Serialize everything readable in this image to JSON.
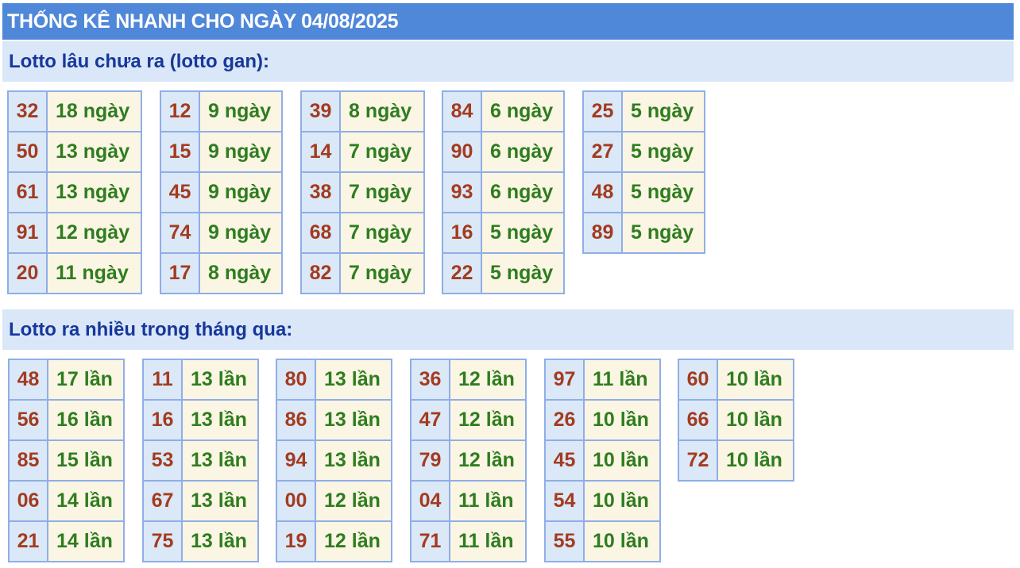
{
  "header": {
    "title": "THỐNG KÊ NHANH CHO NGÀY 04/08/2025"
  },
  "sections": {
    "gan": {
      "title": "Lotto lâu chưa ra (lotto gan):",
      "groups": [
        [
          {
            "number": "32",
            "value": "18 ngày"
          },
          {
            "number": "50",
            "value": "13 ngày"
          },
          {
            "number": "61",
            "value": "13 ngày"
          },
          {
            "number": "91",
            "value": "12 ngày"
          },
          {
            "number": "20",
            "value": "11 ngày"
          }
        ],
        [
          {
            "number": "12",
            "value": "9 ngày"
          },
          {
            "number": "15",
            "value": "9 ngày"
          },
          {
            "number": "45",
            "value": "9 ngày"
          },
          {
            "number": "74",
            "value": "9 ngày"
          },
          {
            "number": "17",
            "value": "8 ngày"
          }
        ],
        [
          {
            "number": "39",
            "value": "8 ngày"
          },
          {
            "number": "14",
            "value": "7 ngày"
          },
          {
            "number": "38",
            "value": "7 ngày"
          },
          {
            "number": "68",
            "value": "7 ngày"
          },
          {
            "number": "82",
            "value": "7 ngày"
          }
        ],
        [
          {
            "number": "84",
            "value": "6 ngày"
          },
          {
            "number": "90",
            "value": "6 ngày"
          },
          {
            "number": "93",
            "value": "6 ngày"
          },
          {
            "number": "16",
            "value": "5 ngày"
          },
          {
            "number": "22",
            "value": "5 ngày"
          }
        ],
        [
          {
            "number": "25",
            "value": "5 ngày"
          },
          {
            "number": "27",
            "value": "5 ngày"
          },
          {
            "number": "48",
            "value": "5 ngày"
          },
          {
            "number": "89",
            "value": "5 ngày"
          }
        ]
      ]
    },
    "nhieu": {
      "title": "Lotto ra nhiều trong tháng qua:",
      "groups": [
        [
          {
            "number": "48",
            "value": "17 lần"
          },
          {
            "number": "56",
            "value": "16 lần"
          },
          {
            "number": "85",
            "value": "15 lần"
          },
          {
            "number": "06",
            "value": "14 lần"
          },
          {
            "number": "21",
            "value": "14 lần"
          }
        ],
        [
          {
            "number": "11",
            "value": "13 lần"
          },
          {
            "number": "16",
            "value": "13 lần"
          },
          {
            "number": "53",
            "value": "13 lần"
          },
          {
            "number": "67",
            "value": "13 lần"
          },
          {
            "number": "75",
            "value": "13 lần"
          }
        ],
        [
          {
            "number": "80",
            "value": "13 lần"
          },
          {
            "number": "86",
            "value": "13 lần"
          },
          {
            "number": "94",
            "value": "13 lần"
          },
          {
            "number": "00",
            "value": "12 lần"
          },
          {
            "number": "19",
            "value": "12 lần"
          }
        ],
        [
          {
            "number": "36",
            "value": "12 lần"
          },
          {
            "number": "47",
            "value": "12 lần"
          },
          {
            "number": "79",
            "value": "12 lần"
          },
          {
            "number": "04",
            "value": "11 lần"
          },
          {
            "number": "71",
            "value": "11 lần"
          }
        ],
        [
          {
            "number": "97",
            "value": "11 lần"
          },
          {
            "number": "26",
            "value": "10 lần"
          },
          {
            "number": "45",
            "value": "10 lần"
          },
          {
            "number": "54",
            "value": "10 lần"
          },
          {
            "number": "55",
            "value": "10 lần"
          }
        ],
        [
          {
            "number": "60",
            "value": "10 lần"
          },
          {
            "number": "66",
            "value": "10 lần"
          },
          {
            "number": "72",
            "value": "10 lần"
          }
        ]
      ]
    }
  },
  "colors": {
    "header_bg": "#4f87d9",
    "section_bg": "#d9e7f8",
    "section_text": "#17379a",
    "number_cell_bg": "#dbe8f7",
    "number_text": "#a33b1f",
    "value_cell_bg": "#fbf5e3",
    "value_text": "#2e7d1f",
    "border": "#8faee8"
  }
}
